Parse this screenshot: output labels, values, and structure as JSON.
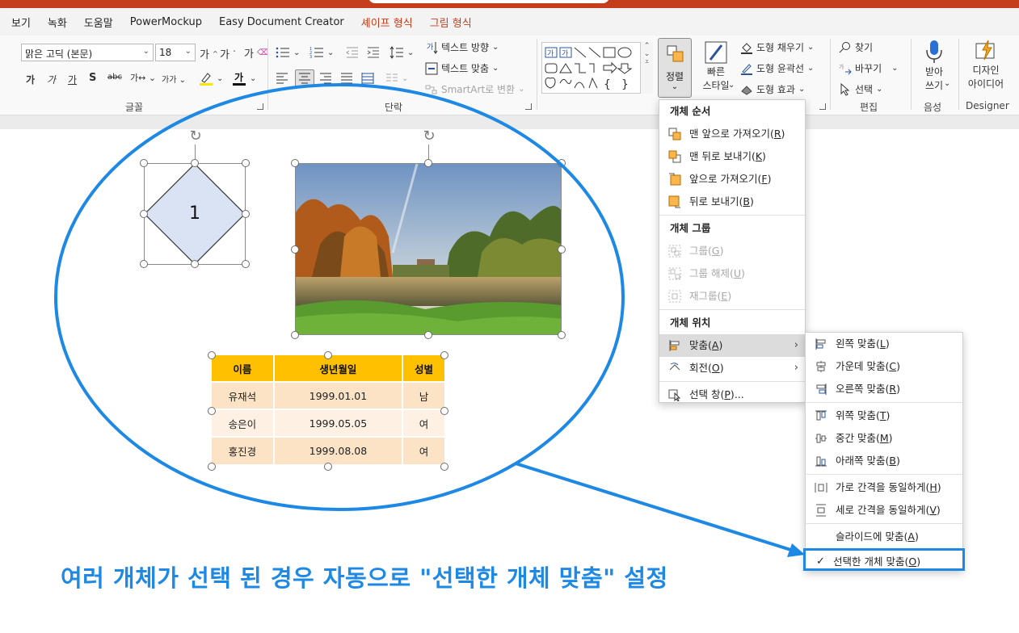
{
  "tabs": [
    {
      "label": "보기",
      "context": false
    },
    {
      "label": "녹화",
      "context": false
    },
    {
      "label": "도움말",
      "context": false
    },
    {
      "label": "PowerMockup",
      "context": false
    },
    {
      "label": "Easy Document Creator",
      "context": false
    },
    {
      "label": "셰이프 형식",
      "context": true
    },
    {
      "label": "그림 형식",
      "context": true
    }
  ],
  "font_group": {
    "font_name": "맑은 고딕 (본문)",
    "font_size": "18",
    "label": "글꼴"
  },
  "paragraph_group": {
    "text_direction": "텍스트 방향",
    "align_text": "텍스트 맞춤",
    "smartart": "SmartArt로 변환",
    "label": "단락"
  },
  "drawing_group": {
    "arrange_label": "정렬",
    "quick_styles_line1": "빠른",
    "quick_styles_line2": "스타일",
    "shape_fill": "도형 채우기",
    "shape_outline": "도형 윤곽선",
    "shape_effects": "도형 효과"
  },
  "editing_group": {
    "find": "찾기",
    "replace": "바꾸기",
    "select": "선택",
    "label": "편집"
  },
  "voice_group": {
    "dictate_line1": "받아",
    "dictate_line2": "쓰기",
    "label": "음성"
  },
  "designer_group": {
    "ideas_line1": "디자인",
    "ideas_line2": "아이디어",
    "label": "Designer"
  },
  "slide": {
    "diamond_text": "1",
    "table": {
      "headers": [
        "이름",
        "생년월일",
        "성별"
      ],
      "rows": [
        [
          "유재석",
          "1999.01.01",
          "남"
        ],
        [
          "송은이",
          "1999.05.05",
          "여"
        ],
        [
          "홍진경",
          "1999.08.08",
          "여"
        ]
      ]
    }
  },
  "arrange_menu": {
    "order_header": "개체 순서",
    "bring_to_front": "맨 앞으로 가져오기",
    "bring_to_front_key": "R",
    "send_to_back": "맨 뒤로 보내기",
    "send_to_back_key": "K",
    "bring_forward": "앞으로 가져오기",
    "bring_forward_key": "F",
    "send_backward": "뒤로 보내기",
    "send_backward_key": "B",
    "group_header": "개체 그룹",
    "group": "그룹",
    "group_key": "G",
    "ungroup": "그룹 해제",
    "ungroup_key": "U",
    "regroup": "재그룹",
    "regroup_key": "E",
    "position_header": "개체 위치",
    "align": "맞춤",
    "align_key": "A",
    "rotate": "회전",
    "rotate_key": "O",
    "selection_pane": "선택 창",
    "selection_pane_key": "P",
    "selection_pane_suffix": "..."
  },
  "align_menu": {
    "left": "왼쪽 맞춤",
    "left_key": "L",
    "center": "가운데 맞춤",
    "center_key": "C",
    "right": "오른쪽 맞춤",
    "right_key": "R",
    "top": "위쪽 맞춤",
    "top_key": "T",
    "middle": "중간 맞춤",
    "middle_key": "M",
    "bottom": "아래쪽 맞춤",
    "bottom_key": "B",
    "distribute_h": "가로 간격을 동일하게",
    "distribute_h_key": "H",
    "distribute_v": "세로 간격을 동일하게",
    "distribute_v_key": "V",
    "align_to_slide": "슬라이드에 맞춤",
    "align_to_slide_key": "A",
    "align_selected": "선택한 개체 맞춤",
    "align_selected_key": "O",
    "check": "✓"
  },
  "caption": "여러 개체가 선택 된 경우 자동으로 \"선택한 개체 맞춤\" 설정",
  "colors": {
    "accent_blue": "#1e88e5",
    "ribbon_context_red": "#c43e1c",
    "table_header": "#ffc000",
    "table_row_dark": "#fde3c6",
    "table_row_light": "#fef1e4",
    "diamond_fill": "#dae3f3"
  }
}
